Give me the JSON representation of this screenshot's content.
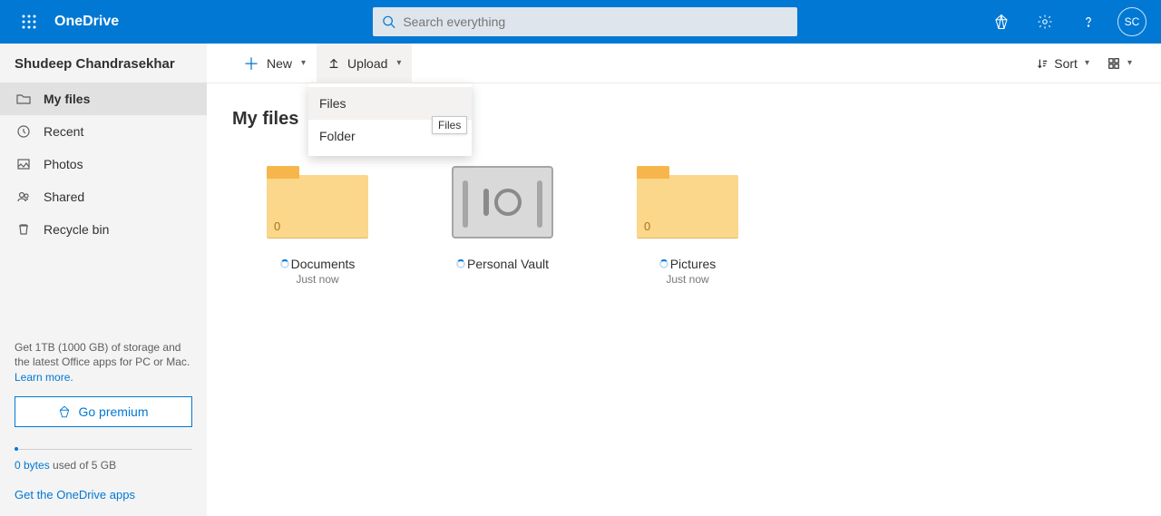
{
  "header": {
    "brand": "OneDrive",
    "search_placeholder": "Search everything",
    "avatar_initials": "SC"
  },
  "sidebar": {
    "user": "Shudeep Chandrasekhar",
    "items": [
      {
        "label": "My files"
      },
      {
        "label": "Recent"
      },
      {
        "label": "Photos"
      },
      {
        "label": "Shared"
      },
      {
        "label": "Recycle bin"
      }
    ],
    "promo_text": "Get 1TB (1000 GB) of storage and the latest Office apps for PC or Mac.",
    "learn_more": "Learn more.",
    "go_premium": "Go premium",
    "storage_used": "0 bytes",
    "storage_total": "used of 5 GB",
    "get_apps": "Get the OneDrive apps"
  },
  "toolbar": {
    "new": "New",
    "upload": "Upload",
    "sort": "Sort"
  },
  "upload_menu": {
    "files": "Files",
    "folder": "Folder",
    "tooltip": "Files"
  },
  "page": {
    "title": "My files"
  },
  "files": [
    {
      "name": "Documents",
      "count": "0",
      "date": "Just now",
      "type": "folder"
    },
    {
      "name": "Personal Vault",
      "type": "vault"
    },
    {
      "name": "Pictures",
      "count": "0",
      "date": "Just now",
      "type": "folder"
    }
  ]
}
